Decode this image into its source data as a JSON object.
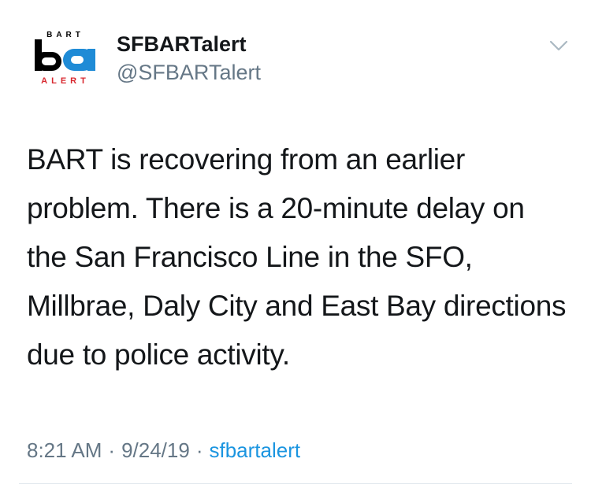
{
  "avatar": {
    "logo_top": "BART",
    "logo_mark": "ba",
    "logo_bottom": "ALERT"
  },
  "user": {
    "display_name": "SFBARTalert",
    "handle": "@SFBARTalert"
  },
  "menu": {
    "icon": "chevron-down-icon"
  },
  "tweet": {
    "text": "BART is recovering from an earlier problem. There is a 20-minute delay on the San Francisco Line in the SFO, Millbrae, Daly City and East Bay directions due to police activity.",
    "time": "8:21 AM",
    "date": "9/24/19",
    "separator": "·",
    "source": "sfbartalert"
  },
  "colors": {
    "text": "#14171a",
    "secondary": "#657786",
    "link": "#1b95e0",
    "logo_blue": "#1f8bd6",
    "logo_red": "#d8282f"
  }
}
